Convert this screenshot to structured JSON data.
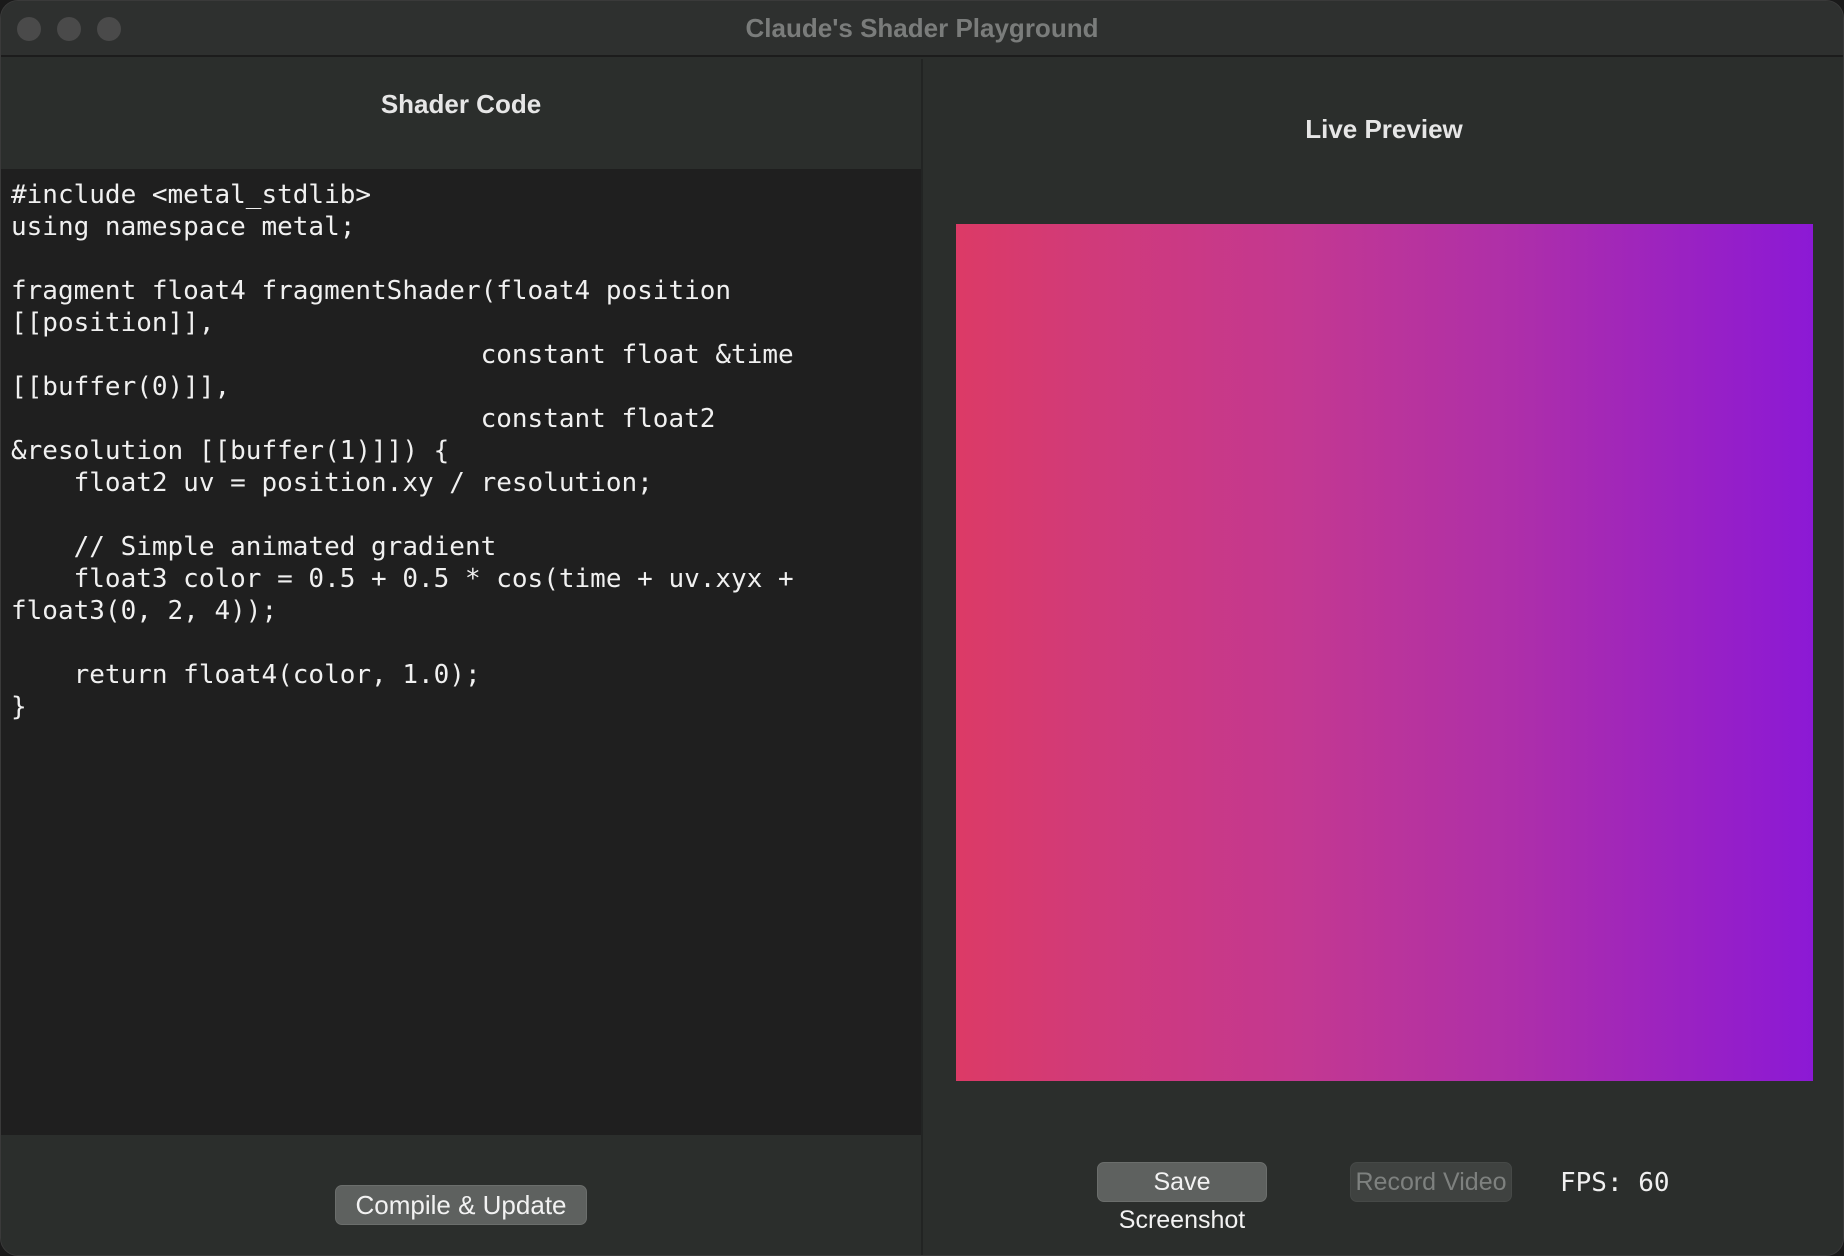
{
  "window": {
    "title": "Claude's Shader Playground"
  },
  "editor": {
    "heading": "Shader Code",
    "code": "#include <metal_stdlib>\nusing namespace metal;\n\nfragment float4 fragmentShader(float4 position\n[[position]],\n                              constant float &time\n[[buffer(0)]],\n                              constant float2\n&resolution [[buffer(1)]]) {\n    float2 uv = position.xy / resolution;\n\n    // Simple animated gradient\n    float3 color = 0.5 + 0.5 * cos(time + uv.xyx +\nfloat3(0, 2, 4));\n\n    return float4(color, 1.0);\n}",
    "compile_button": "Compile & Update"
  },
  "preview": {
    "heading": "Live Preview",
    "gradient_colors": [
      "#dc3a66",
      "#c33891",
      "#8c19d5"
    ],
    "save_button": "Save Screenshot",
    "record_button": "Record Video",
    "fps_label": "FPS: 60"
  }
}
